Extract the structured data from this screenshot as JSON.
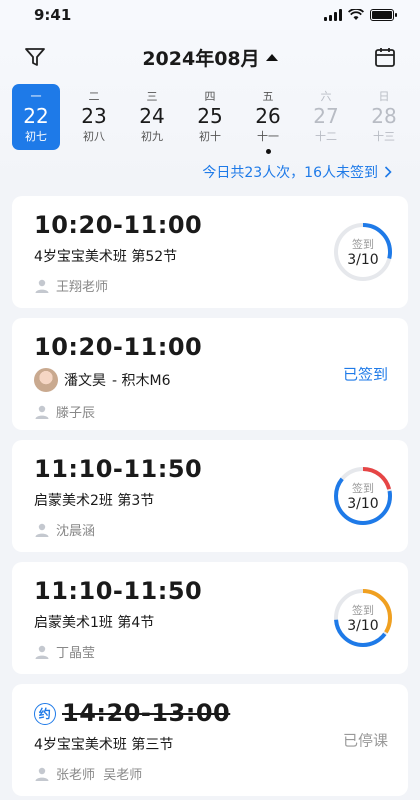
{
  "status_bar": {
    "time": "9:41"
  },
  "header": {
    "month": "2024年08月"
  },
  "week": [
    {
      "weekday": "一",
      "date": "22",
      "lunar": "初七",
      "selected": true
    },
    {
      "weekday": "二",
      "date": "23",
      "lunar": "初八"
    },
    {
      "weekday": "三",
      "date": "24",
      "lunar": "初九"
    },
    {
      "weekday": "四",
      "date": "25",
      "lunar": "初十"
    },
    {
      "weekday": "五",
      "date": "26",
      "lunar": "十一",
      "dot": true
    },
    {
      "weekday": "六",
      "date": "27",
      "lunar": "十二",
      "weekend": true
    },
    {
      "weekday": "日",
      "date": "28",
      "lunar": "十三",
      "weekend": true
    }
  ],
  "summary": "今日共23人次，16人未签到",
  "sessions": [
    {
      "time": "10:20-11:00",
      "title": "4岁宝宝美术班 第52节",
      "teacher": "王翔老师",
      "signin_label": "签到",
      "signin_value": "3/10",
      "ring": [
        {
          "color": "#1e7ae8",
          "fraction": 0.3
        }
      ]
    },
    {
      "time": "10:20-11:00",
      "student": "潘文昊",
      "title": "- 积木M6",
      "teacher": "滕子辰",
      "status": "已签到"
    },
    {
      "time": "11:10-11:50",
      "title": "启蒙美术2班 第3节",
      "teacher": "沈晨涵",
      "signin_label": "签到",
      "signin_value": "3/10",
      "ring": [
        {
          "color": "#e64545",
          "fraction": 0.22
        },
        {
          "color": "#1e7ae8",
          "fraction": 0.65
        }
      ]
    },
    {
      "time": "11:10-11:50",
      "title": "启蒙美术1班 第4节",
      "teacher": "丁晶莹",
      "signin_label": "签到",
      "signin_value": "3/10",
      "ring": [
        {
          "color": "#f0a020",
          "fraction": 0.35
        },
        {
          "color": "#1e7ae8",
          "fraction": 0.4
        }
      ]
    },
    {
      "time": "14:20-13:00",
      "badge": "约",
      "title": "4岁宝宝美术班 第三节",
      "teacher": "张老师  吴老师",
      "status": "已停课",
      "cancelled": true
    }
  ]
}
